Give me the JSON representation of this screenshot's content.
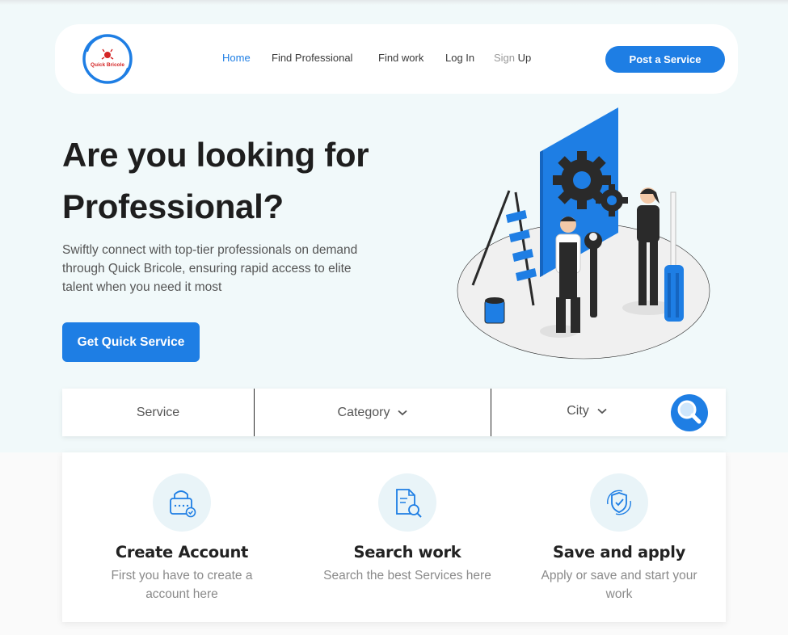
{
  "brand": {
    "logo_text": "Quick Bricole"
  },
  "nav": {
    "links": [
      {
        "label": "Home"
      },
      {
        "label": "Find Professional"
      },
      {
        "label": "Find work"
      },
      {
        "label": "Log In"
      }
    ],
    "signup_part1": "Sign",
    "signup_part2": "Up",
    "post_button": "Post a Service"
  },
  "hero": {
    "title_line1": "Are you looking for",
    "title_line2": "Professional?",
    "subtitle": "Swiftly connect with top-tier professionals on demand through Quick Bricole, ensuring rapid access to elite talent when you need it most",
    "cta": "Get Quick Service"
  },
  "search": {
    "service_placeholder": "Service",
    "category_label": "Category",
    "city_label": "City"
  },
  "steps": [
    {
      "title": "Create Account",
      "desc": "First you have to create a account  here",
      "icon": "lock-icon"
    },
    {
      "title": "Search work",
      "desc": "Search the best Services here",
      "icon": "document-search-icon"
    },
    {
      "title": "Save and apply",
      "desc": "Apply or save and start your work",
      "icon": "shield-check-icon"
    }
  ],
  "colors": {
    "accent": "#1e7ee4",
    "background": "#f1f9fa",
    "logo_red": "#d42424"
  }
}
